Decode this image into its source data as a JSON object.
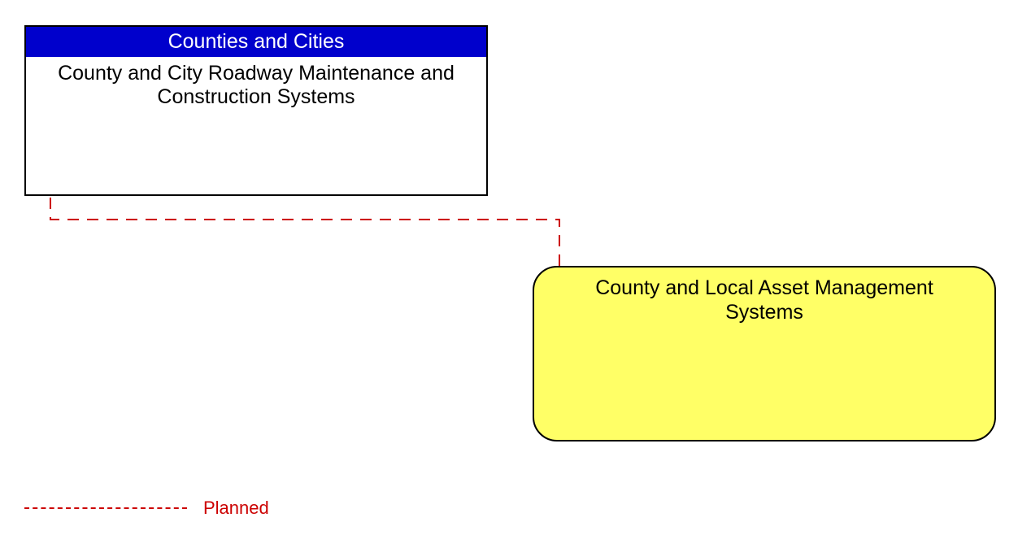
{
  "nodes": {
    "top": {
      "header": "Counties and Cities",
      "title": "County and City Roadway Maintenance and Construction Systems"
    },
    "yellow": {
      "title": "County and Local Asset Management Systems"
    }
  },
  "legend": {
    "planned_label": "Planned"
  },
  "colors": {
    "header_bg": "#0000CC",
    "yellow_bg": "#FFFF66",
    "connector": "#cc0000"
  }
}
